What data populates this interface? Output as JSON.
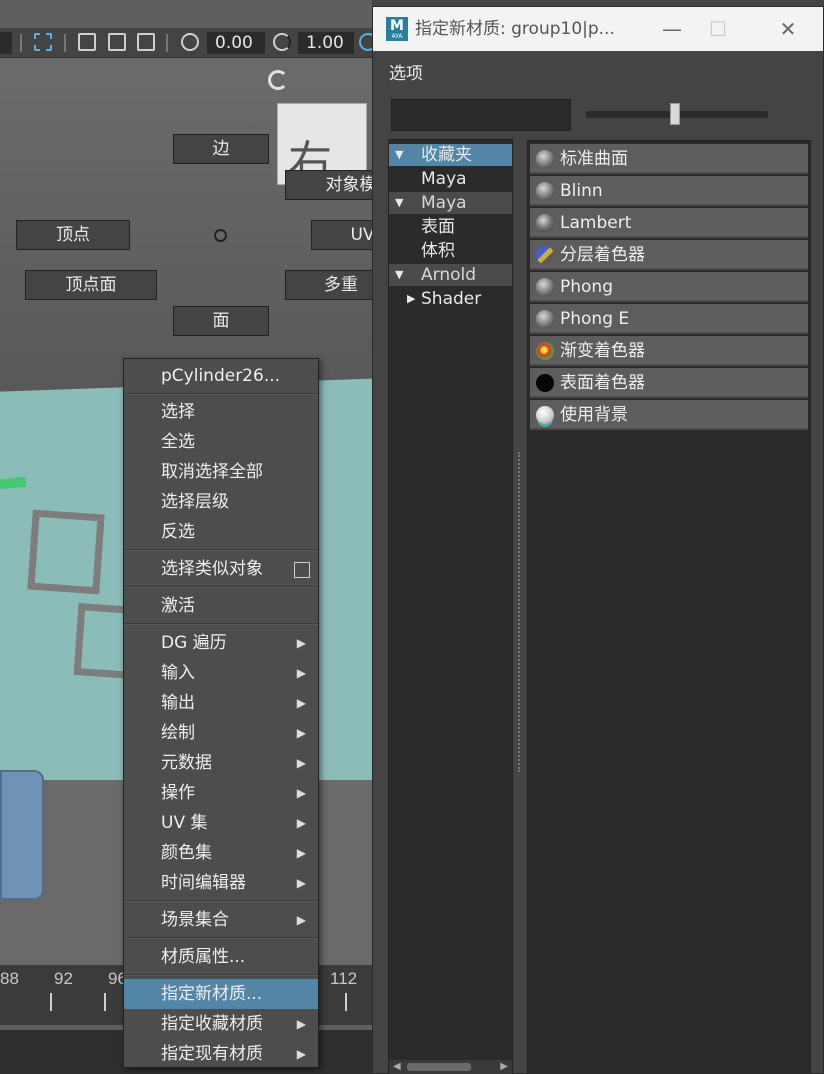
{
  "toolbar": {
    "field_1": "0.00",
    "field_2": "1.00"
  },
  "viewcube": {
    "face_label": "右"
  },
  "timeline": {
    "labels": [
      "88",
      "92",
      "96",
      "112"
    ]
  },
  "marking_menu": {
    "edge": "边",
    "object_mode": "对象模式",
    "vertex": "顶点",
    "uv": "UV",
    "vertex_face": "顶点面",
    "multi": "多重",
    "face": "面"
  },
  "context_menu": {
    "header": "pCylinder26...",
    "items": [
      {
        "label": "选择"
      },
      {
        "label": "全选"
      },
      {
        "label": "取消选择全部"
      },
      {
        "label": "选择层级"
      },
      {
        "label": "反选"
      },
      {
        "label": "选择类似对象"
      },
      {
        "label": "激活"
      },
      {
        "label": "DG 遍历"
      },
      {
        "label": "输入"
      },
      {
        "label": "输出"
      },
      {
        "label": "绘制"
      },
      {
        "label": "元数据"
      },
      {
        "label": "操作"
      },
      {
        "label": "UV 集"
      },
      {
        "label": "颜色集"
      },
      {
        "label": "时间编辑器"
      },
      {
        "label": "场景集合"
      },
      {
        "label": "材质属性..."
      },
      {
        "label": "指定新材质..."
      },
      {
        "label": "指定收藏材质"
      },
      {
        "label": "指定现有材质"
      }
    ]
  },
  "dialog": {
    "app_icon_letter": "M",
    "app_icon_sub": "AYA",
    "title": "指定新材质: group10|p...",
    "window_controls": {
      "minimize": "—",
      "maximize": "☐",
      "close": "✕"
    },
    "menu": {
      "options": "选项"
    },
    "search": {
      "value": "",
      "placeholder": ""
    },
    "slider": {
      "value": 0.49
    },
    "categories": [
      {
        "label": "收藏夹",
        "expanded": true,
        "selected": true
      },
      {
        "label": "Maya"
      },
      {
        "label": "Maya",
        "expanded": true
      },
      {
        "label": "表面"
      },
      {
        "label": "体积"
      },
      {
        "label": "Arnold",
        "expanded": true
      },
      {
        "label": "Shader",
        "expanded": false
      }
    ],
    "shaders": [
      {
        "label": "标准曲面",
        "icon": "grey-sphere-icon",
        "color": "#8a8a8a"
      },
      {
        "label": "Blinn",
        "icon": "grey-sphere-icon",
        "color": "#8a8a8a"
      },
      {
        "label": "Lambert",
        "icon": "grey-sphere-icon",
        "color": "#7a7a7a"
      },
      {
        "label": "分层着色器",
        "icon": "layered-sphere-icon",
        "color": "#c9b13a"
      },
      {
        "label": "Phong",
        "icon": "grey-sphere-icon",
        "color": "#8a8a8a"
      },
      {
        "label": "Phong E",
        "icon": "grey-sphere-icon",
        "color": "#8a8a8a"
      },
      {
        "label": "渐变着色器",
        "icon": "ramp-sphere-icon",
        "color": "#d43b2a"
      },
      {
        "label": "表面着色器",
        "icon": "black-sphere-icon",
        "color": "#050505"
      },
      {
        "label": "使用背景",
        "icon": "background-sphere-icon",
        "color": "#cfcfcf"
      }
    ]
  }
}
